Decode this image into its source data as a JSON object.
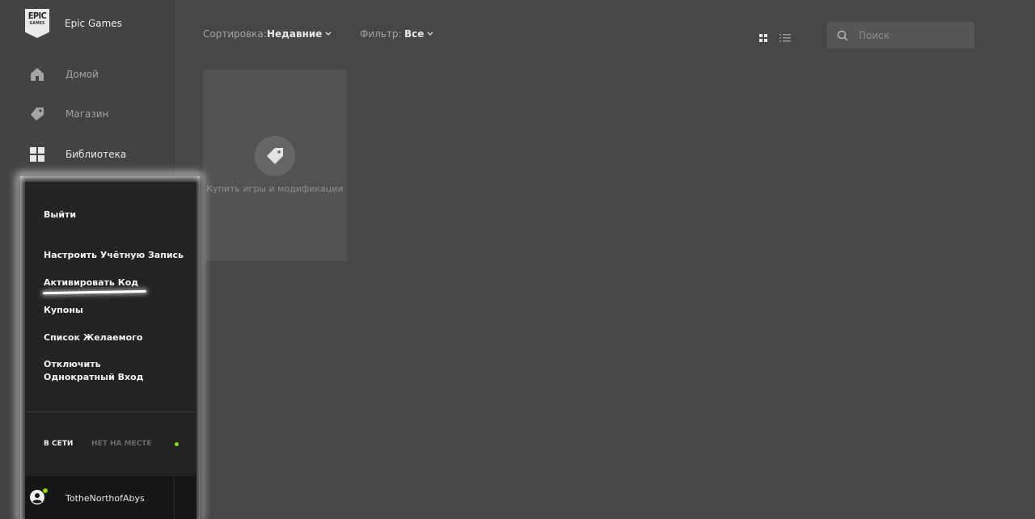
{
  "brand": {
    "logo_line1": "EPIC",
    "logo_line2": "GAMES",
    "name": "Epic Games"
  },
  "nav": [
    {
      "label": "Домой",
      "icon": "home-icon"
    },
    {
      "label": "Магазин",
      "icon": "tag-icon"
    },
    {
      "label": "Библиотека",
      "icon": "grid-icon",
      "active": true
    }
  ],
  "toolbar": {
    "sort_label": "Сортировка:",
    "sort_value": "Недавние",
    "filter_label": "Фильтр:",
    "filter_value": "Все",
    "view_grid_icon": "grid-view-icon",
    "view_list_icon": "list-view-icon"
  },
  "search": {
    "placeholder": "Поиск"
  },
  "library": {
    "card_text": "Купить игры и модификации"
  },
  "account_menu": {
    "items": [
      "Выйти",
      "Настроить Учётную Запись",
      "Активировать Код",
      "Купоны",
      "Список Желаемого",
      "Отключить Однократный Вход"
    ],
    "status_online": "В СЕТИ",
    "status_away": "НЕТ НА МЕСТЕ"
  },
  "user": {
    "name": "TotheNorthofAbys"
  },
  "colors": {
    "accent_green": "#8dd21f",
    "background": "#474747",
    "menu_bg": "#232323"
  }
}
